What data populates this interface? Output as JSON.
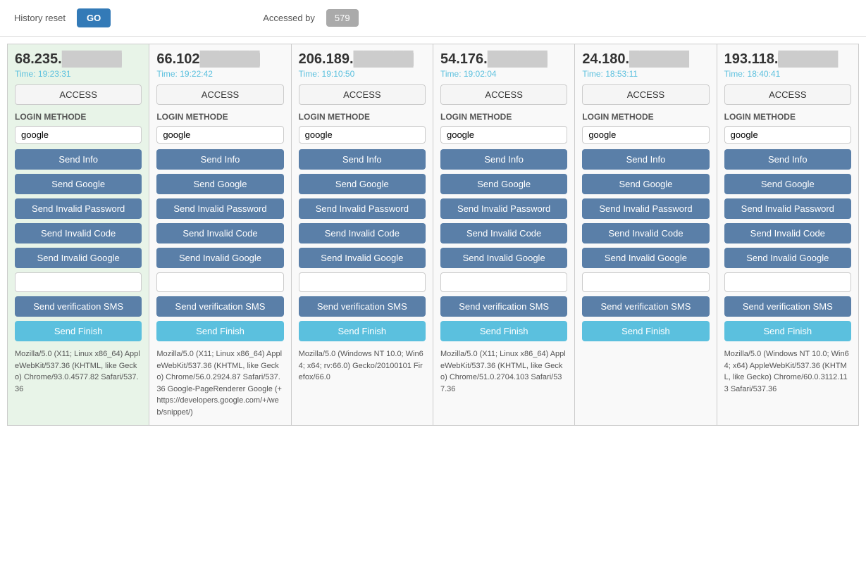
{
  "topbar": {
    "history_reset_label": "History reset",
    "go_label": "GO",
    "accessed_label": "Accessed by",
    "count": "579"
  },
  "columns": [
    {
      "ip": "68.235.",
      "ip_blurred": "██████",
      "time": "Time: 19:23:31",
      "access_label": "ACCESS",
      "login_methode_label": "LOGIN METHODE",
      "login_method_value": "google",
      "buttons": {
        "send_info": "Send Info",
        "send_google": "Send Google",
        "send_invalid_password": "Send Invalid Password",
        "send_invalid_code": "Send Invalid Code",
        "send_invalid_google": "Send Invalid Google",
        "send_verification_sms": "Send verification SMS",
        "send_finish": "Send Finish"
      },
      "sms_value": "",
      "user_agent": "Mozilla/5.0 (X11; Linux x86_64) AppleWebKit/537.36 (KHTML, like Gecko) Chrome/93.0.4577.82 Safari/537.36"
    },
    {
      "ip": "66.102",
      "ip_blurred": "██████",
      "time": "Time: 19:22:42",
      "access_label": "ACCESS",
      "login_methode_label": "LOGIN METHODE",
      "login_method_value": "google",
      "buttons": {
        "send_info": "Send Info",
        "send_google": "Send Google",
        "send_invalid_password": "Send Invalid Password",
        "send_invalid_code": "Send Invalid Code",
        "send_invalid_google": "Send Invalid Google",
        "send_verification_sms": "Send verification SMS",
        "send_finish": "Send Finish"
      },
      "sms_value": "",
      "user_agent": "Mozilla/5.0 (X11; Linux x86_64) AppleWebKit/537.36 (KHTML, like Gecko) Chrome/56.0.2924.87 Safari/537.36 Google-PageRenderer Google (+https://developers.google.com/+/web/snippet/)"
    },
    {
      "ip": "206.189.",
      "ip_blurred": "██████",
      "time": "Time: 19:10:50",
      "access_label": "ACCESS",
      "login_methode_label": "LOGIN METHODE",
      "login_method_value": "google",
      "buttons": {
        "send_info": "Send Info",
        "send_google": "Send Google",
        "send_invalid_password": "Send Invalid Password",
        "send_invalid_code": "Send Invalid Code",
        "send_invalid_google": "Send Invalid Google",
        "send_verification_sms": "Send verification SMS",
        "send_finish": "Send Finish"
      },
      "sms_value": "",
      "user_agent": "Mozilla/5.0 (Windows NT 10.0; Win64; x64; rv:66.0) Gecko/20100101 Firefox/66.0"
    },
    {
      "ip": "54.176.",
      "ip_blurred": "██████",
      "time": "Time: 19:02:04",
      "access_label": "ACCESS",
      "login_methode_label": "LOGIN METHODE",
      "login_method_value": "google",
      "buttons": {
        "send_info": "Send Info",
        "send_google": "Send Google",
        "send_invalid_password": "Send Invalid Password",
        "send_invalid_code": "Send Invalid Code",
        "send_invalid_google": "Send Invalid Google",
        "send_verification_sms": "Send verification SMS",
        "send_finish": "Send Finish"
      },
      "sms_value": "",
      "user_agent": "Mozilla/5.0 (X11; Linux x86_64) AppleWebKit/537.36 (KHTML, like Gecko) Chrome/51.0.2704.103 Safari/537.36"
    },
    {
      "ip": "24.180.",
      "ip_blurred": "██████",
      "time": "Time: 18:53:11",
      "access_label": "ACCESS",
      "login_methode_label": "LOGIN METHODE",
      "login_method_value": "google",
      "buttons": {
        "send_info": "Send Info",
        "send_google": "Send Google",
        "send_invalid_password": "Send Invalid Password",
        "send_invalid_code": "Send Invalid Code",
        "send_invalid_google": "Send Invalid Google",
        "send_verification_sms": "Send verification SMS",
        "send_finish": "Send Finish"
      },
      "sms_value": "",
      "user_agent": ""
    },
    {
      "ip": "193.118.",
      "ip_blurred": "██████",
      "time": "Time: 18:40:41",
      "access_label": "ACCESS",
      "login_methode_label": "LOGIN METHODE",
      "login_method_value": "google",
      "buttons": {
        "send_info": "Send Info",
        "send_google": "Send Google",
        "send_invalid_password": "Send Invalid Password",
        "send_invalid_code": "Send Invalid Code",
        "send_invalid_google": "Send Invalid Google",
        "send_verification_sms": "Send verification SMS",
        "send_finish": "Send Finish"
      },
      "sms_value": "",
      "user_agent": "Mozilla/5.0 (Windows NT 10.0; Win64; x64) AppleWebKit/537.36 (KHTML, like Gecko) Chrome/60.0.3112.113 Safari/537.36"
    }
  ]
}
